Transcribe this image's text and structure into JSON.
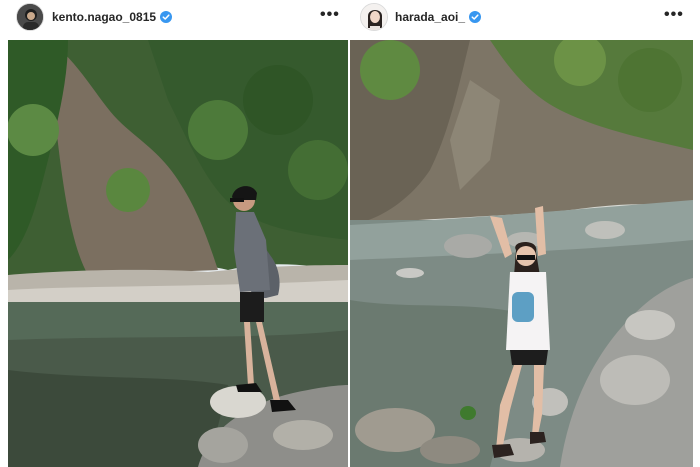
{
  "posts": [
    {
      "username": "kento.nagao_0815",
      "verified": true,
      "more_label": "•••",
      "avatar_icon": "profile-avatar",
      "photo": "river-photo-man-standing-on-rock"
    },
    {
      "username": "harada_aoi_",
      "verified": true,
      "more_label": "•••",
      "avatar_icon": "profile-avatar",
      "photo": "river-photo-woman-arms-raised"
    }
  ],
  "colors": {
    "verified_blue": "#3897f0",
    "text": "#262626",
    "border": "#dbdbdb"
  }
}
